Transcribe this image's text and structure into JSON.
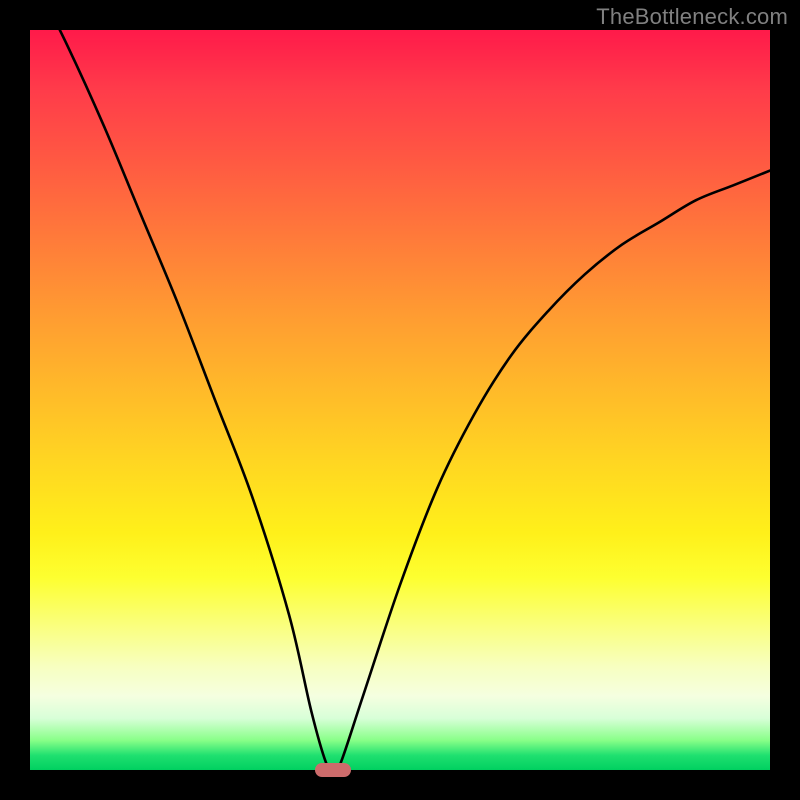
{
  "watermark": "TheBottleneck.com",
  "colors": {
    "background": "#000000",
    "gradient_top": "#ff1a4a",
    "gradient_bottom": "#00d060",
    "curve": "#000000",
    "marker": "#cc6b6b",
    "watermark": "#808080"
  },
  "chart_data": {
    "type": "line",
    "title": "",
    "xlabel": "",
    "ylabel": "",
    "xlim": [
      0,
      100
    ],
    "ylim": [
      0,
      100
    ],
    "grid": false,
    "note": "V-shaped bottleneck curve. y≈0 at the minimum; background gradient from red (top, high) to green (bottom, low).",
    "series": [
      {
        "name": "bottleneck-curve",
        "x": [
          0,
          5,
          10,
          15,
          20,
          25,
          30,
          35,
          38,
          40,
          41,
          42,
          45,
          50,
          55,
          60,
          65,
          70,
          75,
          80,
          85,
          90,
          95,
          100
        ],
        "values": [
          108,
          98,
          87,
          75,
          63,
          50,
          37,
          21,
          8,
          1,
          0,
          1,
          10,
          25,
          38,
          48,
          56,
          62,
          67,
          71,
          74,
          77,
          79,
          81
        ]
      }
    ],
    "marker": {
      "x": 41,
      "y": 0
    }
  }
}
